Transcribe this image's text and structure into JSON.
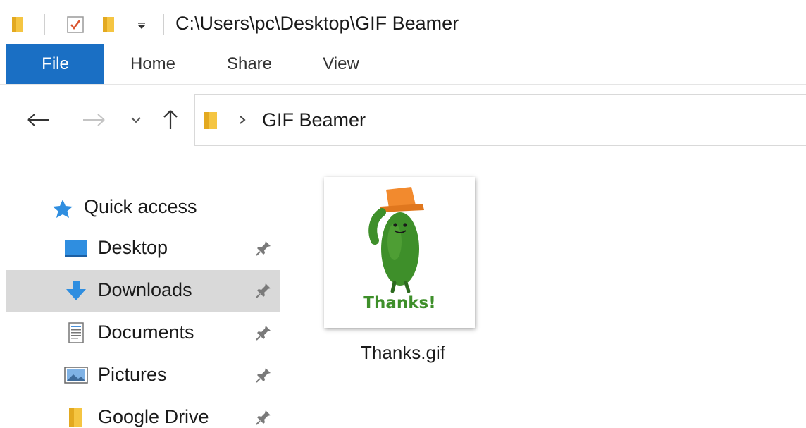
{
  "titlebar": {
    "path": "C:\\Users\\pc\\Desktop\\GIF Beamer"
  },
  "ribbon": {
    "tabs": [
      {
        "label": "File"
      },
      {
        "label": "Home"
      },
      {
        "label": "Share"
      },
      {
        "label": "View"
      }
    ]
  },
  "address": {
    "current": "GIF Beamer"
  },
  "sidebar": {
    "quick_access": "Quick access",
    "items": [
      {
        "label": "Desktop",
        "icon": "desktop-icon"
      },
      {
        "label": "Downloads",
        "icon": "download-arrow-icon",
        "selected": true
      },
      {
        "label": "Documents",
        "icon": "document-icon"
      },
      {
        "label": "Pictures",
        "icon": "pictures-icon"
      },
      {
        "label": "Google Drive",
        "icon": "folder-icon"
      }
    ]
  },
  "content": {
    "files": [
      {
        "name": "Thanks.gif",
        "thumbnail_caption": "Thanks!"
      }
    ]
  },
  "colors": {
    "file_tab": "#1a6fc4",
    "selected_row": "#d9d9d9",
    "folder_yellow": "#f5c542",
    "gif_green": "#3e8f2a"
  }
}
